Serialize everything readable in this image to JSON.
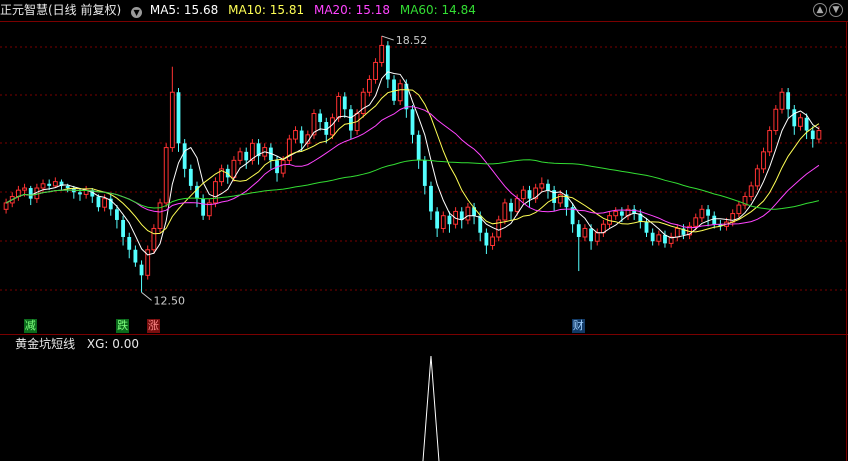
{
  "header": {
    "title": "正元智慧(日线 前复权)",
    "ma5": "MA5: 15.68",
    "ma10": "MA10: 15.81",
    "ma20": "MA20: 15.18",
    "ma60": "MA60: 14.84",
    "colors": {
      "title": "#e8e8e8",
      "ma5": "#ffffff",
      "ma10": "#ffff55",
      "ma20": "#ff44ff",
      "ma60": "#33dd33"
    }
  },
  "indicator": {
    "title": "黄金坑短线",
    "value": "XG: 0.00",
    "colors": {
      "title": "#e8e8e8",
      "value": "#e8e8e8"
    }
  },
  "corner_icons": {
    "up": "▲",
    "down": "▼"
  },
  "signals": [
    {
      "label": "减",
      "candle_index": 4,
      "bg": "#0c6a1c",
      "fg": "#7dff7d"
    },
    {
      "label": "跌",
      "candle_index": 19,
      "bg": "#0c6a1c",
      "fg": "#7dff7d"
    },
    {
      "label": "涨",
      "candle_index": 24,
      "bg": "#7a0f0f",
      "fg": "#ff8a8a"
    },
    {
      "label": "财",
      "candle_index": 93,
      "bg": "#123a66",
      "fg": "#9fd0ff"
    }
  ],
  "chart_data": {
    "type": "candlestick",
    "price_range": [
      11.85,
      18.85
    ],
    "high_label": {
      "text": "18.52",
      "price": 18.52
    },
    "low_label": {
      "text": "12.50",
      "price": 12.5
    },
    "colors": {
      "up": "#ff3232",
      "down": "#54ffff",
      "grid": "#7a0000",
      "divider": "#7a0000"
    },
    "candles": [
      [
        14.45,
        14.6,
        14.35,
        14.7
      ],
      [
        14.6,
        14.75,
        14.5,
        14.85
      ],
      [
        14.75,
        14.9,
        14.65,
        15.0
      ],
      [
        14.9,
        14.95,
        14.75,
        15.05
      ],
      [
        14.95,
        14.7,
        14.55,
        15.0
      ],
      [
        14.7,
        14.95,
        14.6,
        15.05
      ],
      [
        14.95,
        15.05,
        14.85,
        15.15
      ],
      [
        15.05,
        15.0,
        14.9,
        15.15
      ],
      [
        15.0,
        15.1,
        14.95,
        15.2
      ],
      [
        15.1,
        15.0,
        14.9,
        15.15
      ],
      [
        15.0,
        14.95,
        14.85,
        15.05
      ],
      [
        14.95,
        14.85,
        14.7,
        15.0
      ],
      [
        14.85,
        14.8,
        14.65,
        14.95
      ],
      [
        14.8,
        14.9,
        14.7,
        15.0
      ],
      [
        14.9,
        14.75,
        14.6,
        14.95
      ],
      [
        14.75,
        14.5,
        14.4,
        14.8
      ],
      [
        14.5,
        14.7,
        14.4,
        14.8
      ],
      [
        14.7,
        14.45,
        14.3,
        14.8
      ],
      [
        14.45,
        14.2,
        14.0,
        14.55
      ],
      [
        14.2,
        13.8,
        13.6,
        14.3
      ],
      [
        13.8,
        13.5,
        13.3,
        13.9
      ],
      [
        13.5,
        13.2,
        13.1,
        13.6
      ],
      [
        13.15,
        12.9,
        12.5,
        13.25
      ],
      [
        12.9,
        13.5,
        12.8,
        13.6
      ],
      [
        13.5,
        14.0,
        13.4,
        14.1
      ],
      [
        14.0,
        14.6,
        13.9,
        14.7
      ],
      [
        14.6,
        15.9,
        14.5,
        16.0
      ],
      [
        15.9,
        17.2,
        15.8,
        17.8
      ],
      [
        17.2,
        16.0,
        15.8,
        17.3
      ],
      [
        16.0,
        15.4,
        15.2,
        16.1
      ],
      [
        15.4,
        15.0,
        14.9,
        15.5
      ],
      [
        15.0,
        14.7,
        14.5,
        15.1
      ],
      [
        14.7,
        14.3,
        14.2,
        14.8
      ],
      [
        14.3,
        14.6,
        14.2,
        14.7
      ],
      [
        14.6,
        15.1,
        14.5,
        15.2
      ],
      [
        15.1,
        15.4,
        15.0,
        15.5
      ],
      [
        15.4,
        15.2,
        15.05,
        15.5
      ],
      [
        15.2,
        15.6,
        15.1,
        15.7
      ],
      [
        15.6,
        15.8,
        15.5,
        15.9
      ],
      [
        15.8,
        15.6,
        15.4,
        15.9
      ],
      [
        15.6,
        16.0,
        15.5,
        16.1
      ],
      [
        16.0,
        15.7,
        15.5,
        16.1
      ],
      [
        15.7,
        15.9,
        15.6,
        16.0
      ],
      [
        15.9,
        15.6,
        15.4,
        16.0
      ],
      [
        15.6,
        15.3,
        15.1,
        15.7
      ],
      [
        15.3,
        15.6,
        15.2,
        15.7
      ],
      [
        15.6,
        16.1,
        15.5,
        16.2
      ],
      [
        16.1,
        16.3,
        16.0,
        16.4
      ],
      [
        16.3,
        16.0,
        15.8,
        16.4
      ],
      [
        16.0,
        16.2,
        15.9,
        16.3
      ],
      [
        16.2,
        16.7,
        16.1,
        16.8
      ],
      [
        16.7,
        16.5,
        16.3,
        16.8
      ],
      [
        16.5,
        16.2,
        16.0,
        16.6
      ],
      [
        16.2,
        16.6,
        16.1,
        16.7
      ],
      [
        16.6,
        17.1,
        16.5,
        17.2
      ],
      [
        17.1,
        16.8,
        16.6,
        17.2
      ],
      [
        16.8,
        16.3,
        16.1,
        16.9
      ],
      [
        16.3,
        16.7,
        16.2,
        16.8
      ],
      [
        16.7,
        17.2,
        16.6,
        17.3
      ],
      [
        17.2,
        17.5,
        17.1,
        17.6
      ],
      [
        17.5,
        17.9,
        17.4,
        18.0
      ],
      [
        17.9,
        18.3,
        17.8,
        18.52
      ],
      [
        18.3,
        17.5,
        17.3,
        18.4
      ],
      [
        17.5,
        17.0,
        16.9,
        17.6
      ],
      [
        17.0,
        17.4,
        16.9,
        17.5
      ],
      [
        17.4,
        16.8,
        16.6,
        17.5
      ],
      [
        16.8,
        16.2,
        16.0,
        16.9
      ],
      [
        16.2,
        15.6,
        15.4,
        16.3
      ],
      [
        15.6,
        15.0,
        14.8,
        15.7
      ],
      [
        15.0,
        14.4,
        14.2,
        15.1
      ],
      [
        14.4,
        14.0,
        13.8,
        14.5
      ],
      [
        14.0,
        14.3,
        13.9,
        14.4
      ],
      [
        14.3,
        14.1,
        13.9,
        14.4
      ],
      [
        14.1,
        14.4,
        14.0,
        14.5
      ],
      [
        14.4,
        14.2,
        14.0,
        14.5
      ],
      [
        14.2,
        14.5,
        14.1,
        14.6
      ],
      [
        14.5,
        14.3,
        14.1,
        14.6
      ],
      [
        14.3,
        13.9,
        13.7,
        14.4
      ],
      [
        13.9,
        13.6,
        13.4,
        14.0
      ],
      [
        13.6,
        13.8,
        13.5,
        13.9
      ],
      [
        13.8,
        14.2,
        13.7,
        14.3
      ],
      [
        14.2,
        14.6,
        14.1,
        14.7
      ],
      [
        14.6,
        14.4,
        14.2,
        14.7
      ],
      [
        14.4,
        14.7,
        14.3,
        14.8
      ],
      [
        14.7,
        14.9,
        14.6,
        15.0
      ],
      [
        14.9,
        14.7,
        14.5,
        15.0
      ],
      [
        14.7,
        14.95,
        14.6,
        15.05
      ],
      [
        14.95,
        15.05,
        14.85,
        15.2
      ],
      [
        15.05,
        14.9,
        14.7,
        15.15
      ],
      [
        14.9,
        14.6,
        14.4,
        15.0
      ],
      [
        14.6,
        14.8,
        14.5,
        14.9
      ],
      [
        14.8,
        14.5,
        14.3,
        14.9
      ],
      [
        14.5,
        14.1,
        13.9,
        14.6
      ],
      [
        14.1,
        13.8,
        13.0,
        14.2
      ],
      [
        13.8,
        14.0,
        13.7,
        14.1
      ],
      [
        14.0,
        13.7,
        13.5,
        14.1
      ],
      [
        13.7,
        13.9,
        13.6,
        14.0
      ],
      [
        13.9,
        14.1,
        13.8,
        14.2
      ],
      [
        14.1,
        14.3,
        14.0,
        14.4
      ],
      [
        14.3,
        14.4,
        14.2,
        14.5
      ],
      [
        14.4,
        14.3,
        14.15,
        14.5
      ],
      [
        14.3,
        14.45,
        14.2,
        14.55
      ],
      [
        14.45,
        14.35,
        14.2,
        14.55
      ],
      [
        14.35,
        14.15,
        14.0,
        14.45
      ],
      [
        14.15,
        13.9,
        13.8,
        14.25
      ],
      [
        13.9,
        13.7,
        13.6,
        14.0
      ],
      [
        13.7,
        13.85,
        13.6,
        13.95
      ],
      [
        13.85,
        13.65,
        13.55,
        13.95
      ],
      [
        13.65,
        13.8,
        13.55,
        13.9
      ],
      [
        13.8,
        14.0,
        13.7,
        14.1
      ],
      [
        14.0,
        13.85,
        13.75,
        14.1
      ],
      [
        13.85,
        14.05,
        13.75,
        14.15
      ],
      [
        14.05,
        14.25,
        13.95,
        14.35
      ],
      [
        14.25,
        14.45,
        14.15,
        14.55
      ],
      [
        14.45,
        14.3,
        14.05,
        14.55
      ],
      [
        14.3,
        14.1,
        14.0,
        14.4
      ],
      [
        14.1,
        14.05,
        13.95,
        14.2
      ],
      [
        14.05,
        14.15,
        13.95,
        14.25
      ],
      [
        14.15,
        14.35,
        14.05,
        14.45
      ],
      [
        14.35,
        14.55,
        14.25,
        14.65
      ],
      [
        14.55,
        14.75,
        14.45,
        14.85
      ],
      [
        14.75,
        15.0,
        14.65,
        15.1
      ],
      [
        15.0,
        15.4,
        14.9,
        15.5
      ],
      [
        15.4,
        15.8,
        15.3,
        15.9
      ],
      [
        15.8,
        16.3,
        15.7,
        16.4
      ],
      [
        16.3,
        16.8,
        16.2,
        16.9
      ],
      [
        16.8,
        17.2,
        16.7,
        17.3
      ],
      [
        17.2,
        16.8,
        16.6,
        17.3
      ],
      [
        16.8,
        16.4,
        16.2,
        16.9
      ],
      [
        16.4,
        16.6,
        16.3,
        16.7
      ],
      [
        16.6,
        16.3,
        16.1,
        16.7
      ],
      [
        16.3,
        16.1,
        15.9,
        16.4
      ],
      [
        16.1,
        16.3,
        16.0,
        16.4
      ]
    ],
    "ma_series": [
      {
        "name": "MA5",
        "color": "#ffffff",
        "period": 5
      },
      {
        "name": "MA10",
        "color": "#ffff55",
        "period": 10
      },
      {
        "name": "MA20",
        "color": "#ff44ff",
        "period": 20
      },
      {
        "name": "MA60",
        "color": "#33dd33",
        "period": 60
      }
    ],
    "indicator": {
      "series": [
        {
          "name": "XG",
          "values": {
            "spike_at": 69,
            "spike_value": 1
          }
        }
      ],
      "y_range": [
        0,
        1
      ],
      "color": "#ffffff"
    }
  }
}
